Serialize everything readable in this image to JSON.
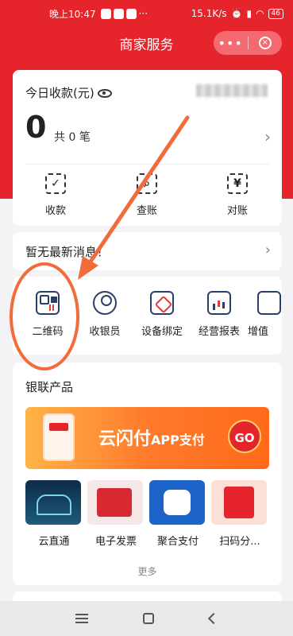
{
  "status": {
    "time": "晚上10:47",
    "speed": "15.1K/s",
    "battery": "46"
  },
  "header": {
    "title": "商家服务",
    "more": "•••",
    "close": "×"
  },
  "income": {
    "label": "今日收款(元)",
    "value": "0",
    "count_prefix": "共",
    "count": "0",
    "count_suffix": "笔",
    "actions": [
      {
        "label": "收款",
        "icon": "scan-check-icon"
      },
      {
        "label": "查账",
        "icon": "search-doc-icon"
      },
      {
        "label": "对账",
        "icon": "yuan-icon"
      }
    ]
  },
  "notice": {
    "text": "暂无最新消息！"
  },
  "menu": {
    "items": [
      {
        "label": "二维码",
        "icon": "qr-grid-icon"
      },
      {
        "label": "收银员",
        "icon": "person-icon"
      },
      {
        "label": "设备绑定",
        "icon": "link-icon"
      },
      {
        "label": "经营报表",
        "icon": "chart-icon"
      },
      {
        "label": "增值",
        "icon": "plus-icon"
      }
    ]
  },
  "products": {
    "title": "银联产品",
    "banner": {
      "main": "云闪付",
      "sub": "APP支付",
      "go": "GO"
    },
    "items": [
      {
        "label": "云直通"
      },
      {
        "label": "电子发票"
      },
      {
        "label": "聚合支付"
      },
      {
        "label": "扫码分..."
      }
    ],
    "more": "更多"
  },
  "colors": {
    "brand": "#e6242c",
    "annotation": "#f26b3a"
  }
}
